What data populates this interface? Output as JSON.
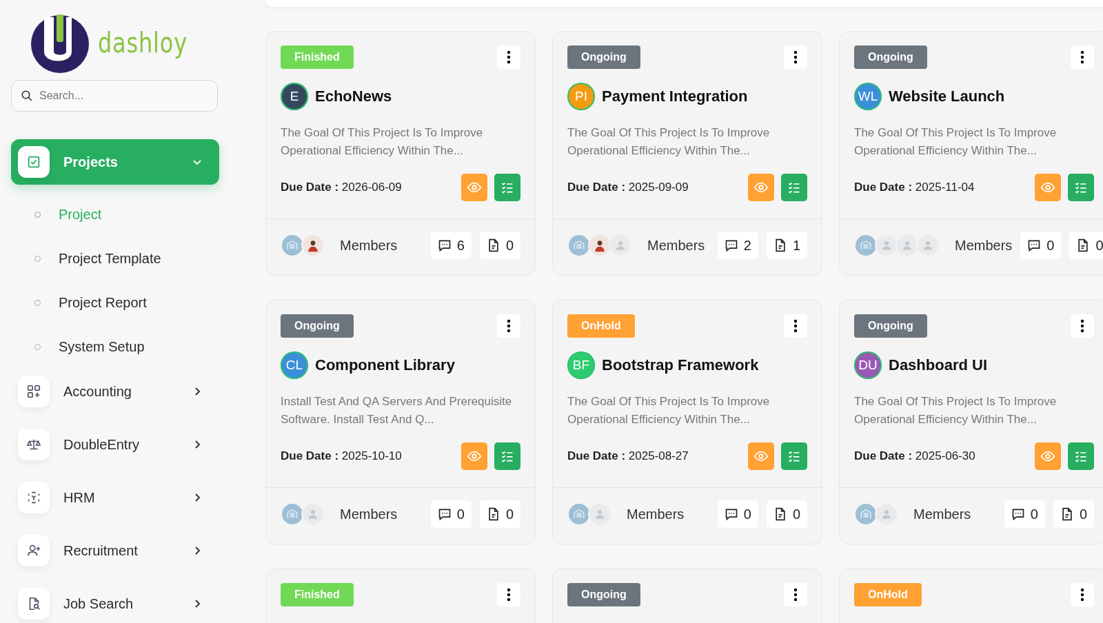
{
  "sidebar": {
    "brand": "dashloy",
    "search": {
      "placeholder": "Search..."
    },
    "menu": [
      {
        "label": "Projects",
        "selected": true,
        "expanded": true,
        "children": [
          {
            "label": "Project",
            "selected": true
          },
          {
            "label": "Project Template",
            "selected": false
          },
          {
            "label": "Project Report",
            "selected": false
          },
          {
            "label": "System Setup",
            "selected": false
          }
        ]
      },
      {
        "label": "Accounting",
        "selected": false,
        "expanded": false
      },
      {
        "label": "DoubleEntry",
        "selected": false,
        "expanded": false
      },
      {
        "label": "HRM",
        "selected": false,
        "expanded": false
      },
      {
        "label": "Recruitment",
        "selected": false,
        "expanded": false
      },
      {
        "label": "Job Search",
        "selected": false,
        "expanded": false
      }
    ]
  },
  "projects": [
    {
      "status": {
        "label": "Finished",
        "color": "#72d957"
      },
      "avatar": {
        "initials": "E",
        "color": "#34495e"
      },
      "name": "EchoNews",
      "description": "The Goal Of This Project Is To Improve Operational Efficiency Within The...",
      "due_label": "Due Date :",
      "due_date": "2026-06-09",
      "members": [
        {
          "kind": "building"
        },
        {
          "kind": "person"
        }
      ],
      "members_label": "Members",
      "comments": "6",
      "files": "0"
    },
    {
      "status": {
        "label": "Ongoing",
        "color": "#6c757d"
      },
      "avatar": {
        "initials": "PI",
        "color": "#f39c12"
      },
      "name": "Payment Integration",
      "description": "The Goal Of This Project Is To Improve Operational Efficiency Within The...",
      "due_label": "Due Date :",
      "due_date": "2025-09-09",
      "members": [
        {
          "kind": "building"
        },
        {
          "kind": "person"
        },
        {
          "kind": "placeholder"
        }
      ],
      "members_label": "Members",
      "comments": "2",
      "files": "1"
    },
    {
      "status": {
        "label": "Ongoing",
        "color": "#6c757d"
      },
      "avatar": {
        "initials": "WL",
        "color": "#3b8fd9"
      },
      "name": "Website Launch",
      "description": "The Goal Of This Project Is To Improve Operational Efficiency Within The...",
      "due_label": "Due Date :",
      "due_date": "2025-11-04",
      "members": [
        {
          "kind": "building"
        },
        {
          "kind": "placeholder"
        },
        {
          "kind": "placeholder"
        },
        {
          "kind": "placeholder"
        }
      ],
      "members_label": "Members",
      "comments": "0",
      "files": "0"
    },
    {
      "status": {
        "label": "Ongoing",
        "color": "#6c757d"
      },
      "avatar": {
        "initials": "CL",
        "color": "#3b8fd9"
      },
      "name": "Component Library",
      "description": "Install Test And QA Servers And Prerequisite Software. Install Test And Q...",
      "due_label": "Due Date :",
      "due_date": "2025-10-10",
      "members": [
        {
          "kind": "building"
        },
        {
          "kind": "placeholder"
        }
      ],
      "members_label": "Members",
      "comments": "0",
      "files": "0"
    },
    {
      "status": {
        "label": "OnHold",
        "color": "#ffa133"
      },
      "avatar": {
        "initials": "BF",
        "color": "#2ecc71"
      },
      "name": "Bootstrap Framework",
      "description": "The Goal Of This Project Is To Improve Operational Efficiency Within The...",
      "due_label": "Due Date :",
      "due_date": "2025-08-27",
      "members": [
        {
          "kind": "building"
        },
        {
          "kind": "placeholder"
        }
      ],
      "members_label": "Members",
      "comments": "0",
      "files": "0"
    },
    {
      "status": {
        "label": "Ongoing",
        "color": "#6c757d"
      },
      "avatar": {
        "initials": "DU",
        "color": "#9b59b6"
      },
      "name": "Dashboard UI",
      "description": "The Goal Of This Project Is To Improve Operational Efficiency Within The...",
      "due_label": "Due Date :",
      "due_date": "2025-06-30",
      "members": [
        {
          "kind": "building"
        },
        {
          "kind": "placeholder"
        }
      ],
      "members_label": "Members",
      "comments": "0",
      "files": "0"
    },
    {
      "status": {
        "label": "Finished",
        "color": "#72d957"
      }
    },
    {
      "status": {
        "label": "Ongoing",
        "color": "#6c757d"
      }
    },
    {
      "status": {
        "label": "OnHold",
        "color": "#ffa133"
      }
    }
  ]
}
